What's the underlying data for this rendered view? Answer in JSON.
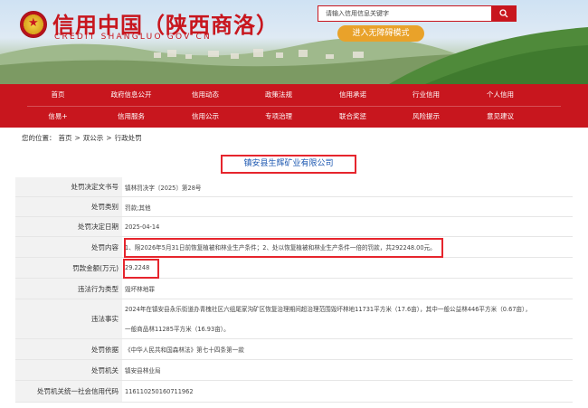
{
  "header": {
    "title": "信用中国（陕西商洛）",
    "subtitle": "CREDIT SHANGLUO GOV CN",
    "search_placeholder": "请输入信用信息关键字",
    "barrier_free_label": "进入无障碍模式"
  },
  "nav": {
    "row1": [
      "首页",
      "政府信息公开",
      "信用动态",
      "政策法规",
      "信用承诺",
      "行业信用",
      "个人信用"
    ],
    "row2": [
      "信易+",
      "信用服务",
      "信用公示",
      "专项治理",
      "联合奖惩",
      "风险提示",
      "意见建议"
    ]
  },
  "breadcrumb": {
    "prefix": "您的位置：",
    "items": [
      "首页",
      "双公示",
      "行政处罚"
    ],
    "separator": ">"
  },
  "entity_name": "镇安县生辉矿业有限公司",
  "record": [
    {
      "label": "处罚决定文书号",
      "value": "镇林罚决字〔2025〕第28号"
    },
    {
      "label": "处罚类别",
      "value": "罚款;其他"
    },
    {
      "label": "处罚决定日期",
      "value": "2025-04-14"
    },
    {
      "label": "处罚内容",
      "value": "1、限2026年5月31日前恢复植被和林业生产条件；2、处以恢复植被和林业生产条件一倍的罚款，共292248.00元。"
    },
    {
      "label": "罚款金额(万元)",
      "value": "29.2248"
    },
    {
      "label": "违法行为类型",
      "value": "毁坏林地罪"
    },
    {
      "label": "违法事实",
      "value": "2024年在镇安县永乐街道办青槐社区六组尾家沟矿区恢复治理期间超治理范围毁坏林地11731平方米（17.6亩），其中一般公益林446平方米（0.67亩），",
      "value2": "一般商品林11285平方米（16.93亩）。"
    },
    {
      "label": "处罚依据",
      "value": "《中华人民共和国森林法》第七十四条第一款"
    },
    {
      "label": "处罚机关",
      "value": "镇安县林业局"
    },
    {
      "label": "处罚机关统一社会信用代码",
      "value": "11611025016071196​2"
    }
  ],
  "colors": {
    "brand_red": "#c8161e",
    "highlight_red": "#e6252d",
    "link_blue": "#1a56b0",
    "accent_orange": "#e9a22a"
  }
}
